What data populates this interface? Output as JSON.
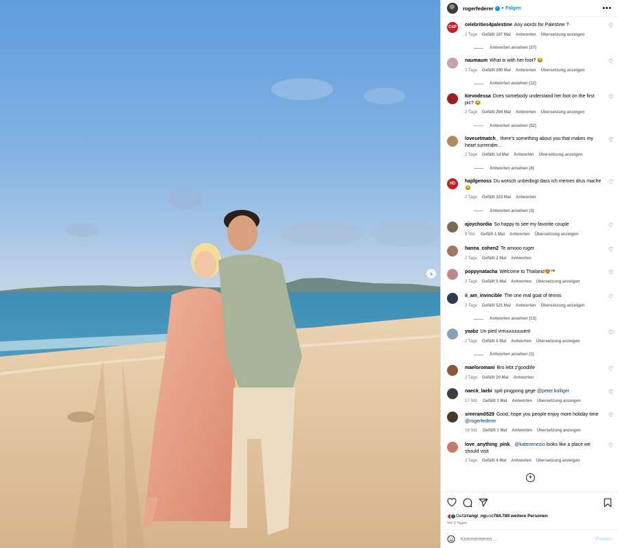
{
  "post": {
    "author": "rogerfederer",
    "separator": "•",
    "follow_label": "Folgen",
    "more_glyph": "•••",
    "carousel_next": "›"
  },
  "comments": [
    {
      "user": "celebrities4palestine",
      "text": "Any words for Palestine ?",
      "time": "2 Tage",
      "likes": "Gefällt 107 Mal",
      "reply": "Antworten",
      "translate": "Übersetzung anzeigen",
      "replies": "Antworten ansehen (37)",
      "avatar_text": "C4P",
      "avatar_color": "#d01c24"
    },
    {
      "user": "naumaum",
      "text": "What is with her foot? 😂",
      "time": "2 Tage",
      "likes": "Gefällt 290 Mal",
      "reply": "Antworten",
      "translate": "Übersetzung anzeigen",
      "replies": "Antworten ansehen (12)",
      "avatar_text": "",
      "avatar_color": "#c9a0a8"
    },
    {
      "user": "kievodessa",
      "text": "Does somebody understand her foot on the first pic? 😂",
      "time": "2 Tage",
      "likes": "Gefällt 294 Mal",
      "reply": "Antworten",
      "translate": "Übersetzung anzeigen",
      "replies": "Antworten ansehen (52)",
      "avatar_text": "",
      "avatar_color": "#9c1f22"
    },
    {
      "user": "lovesetmatch_",
      "text": "there's something about you that makes my heart surrender...",
      "time": "2 Tage",
      "likes": "Gefällt 1d Mal",
      "reply": "Antworten",
      "translate": "Übersetzung anzeigen",
      "replies": "Antworten ansehen (4)",
      "avatar_text": "",
      "avatar_color": "#b08a5a"
    },
    {
      "user": "hajdgenoss",
      "text": "Du wotsch unbedingt dass ich memes drus mache 😂",
      "time": "2 Tage",
      "likes": "Gefällt 323 Mal",
      "reply": "Antworten",
      "translate": "",
      "replies": "Antworten ansehen (3)",
      "avatar_text": "HD",
      "avatar_color": "#c41e1e"
    },
    {
      "user": "ajoychordia",
      "text": "So happy to see my favorite couple",
      "time": "9 Std.",
      "likes": "Gefällt 1 Mal",
      "reply": "Antworten",
      "translate": "Übersetzung anzeigen",
      "replies": "",
      "avatar_text": "",
      "avatar_color": "#7a6a55"
    },
    {
      "user": "hanna_cohen2",
      "text": "Te amooo roger",
      "time": "2 Tage",
      "likes": "Gefällt 2 Mal",
      "reply": "Antworten",
      "translate": "",
      "replies": "",
      "avatar_text": "",
      "avatar_color": "#a07860"
    },
    {
      "user": "poppynatacha",
      "text": "Welcome to Thailand😍™",
      "time": "2 Tage",
      "likes": "Gefällt 5 Mal",
      "reply": "Antworten",
      "translate": "Übersetzung anzeigen",
      "replies": "",
      "avatar_text": "",
      "avatar_color": "#c08a8a"
    },
    {
      "user": "ii_am_invincible",
      "text": "The one real goat of tennis",
      "time": "2 Tage",
      "likes": "Gefällt 521 Mal",
      "reply": "Antworten",
      "translate": "Übersetzung anzeigen",
      "replies": "Antworten ansehen (13)",
      "avatar_text": "",
      "avatar_color": "#2b3a55"
    },
    {
      "user": "yaabz",
      "text": "Un pied vreuuuuuuuent",
      "time": "2 Tage",
      "likes": "Gefällt 5 Mal",
      "reply": "Antworten",
      "translate": "Übersetzung anzeigen",
      "replies": "Antworten ansehen (1)",
      "avatar_text": "",
      "avatar_color": "#8aa0b8"
    },
    {
      "user": "maeloromani",
      "text": "Bro lebt z'goodlife",
      "time": "2 Tage",
      "likes": "Gefällt 20 Mal",
      "reply": "Antworten",
      "translate": "",
      "replies": "",
      "avatar_text": "",
      "avatar_color": "#8a5a3a"
    },
    {
      "user": "naeck_laebi",
      "text": "spili pingpong gege ",
      "mention": "@peter.bolliger",
      "time": "17 Std.",
      "likes": "Gefällt 1 Mal",
      "reply": "Antworten",
      "translate": "Übersetzung anzeigen",
      "replies": "",
      "avatar_text": "",
      "avatar_color": "#3a3d44"
    },
    {
      "user": "sreeram0529",
      "text": "Good, hope you people enjoy more holiday time ",
      "mention": "@rogerfederer",
      "time": "19 Std.",
      "likes": "Gefällt 1 Mal",
      "reply": "Antworten",
      "translate": "Übersetzung anzeigen",
      "replies": "",
      "avatar_text": "",
      "avatar_color": "#4a3a2a"
    },
    {
      "user": "love_anything_pink_",
      "text": " looks like a place we should visit",
      "mention_first": "@katevenezio",
      "time": "2 Tage",
      "likes": "Gefällt 4 Mal",
      "reply": "Antworten",
      "translate": "Übersetzung anzeigen",
      "replies": "",
      "avatar_text": "",
      "avatar_color": "#c77a6a"
    }
  ],
  "load_more": "+",
  "likes": {
    "prefix": "Gefällt ",
    "first_user": "angi_ng",
    "middle": " und ",
    "count": "784.789 weitere Personen"
  },
  "date": "Vor 2 Tagen",
  "comment_box": {
    "placeholder": "Kommentieren ...",
    "post_label": "Posten"
  }
}
